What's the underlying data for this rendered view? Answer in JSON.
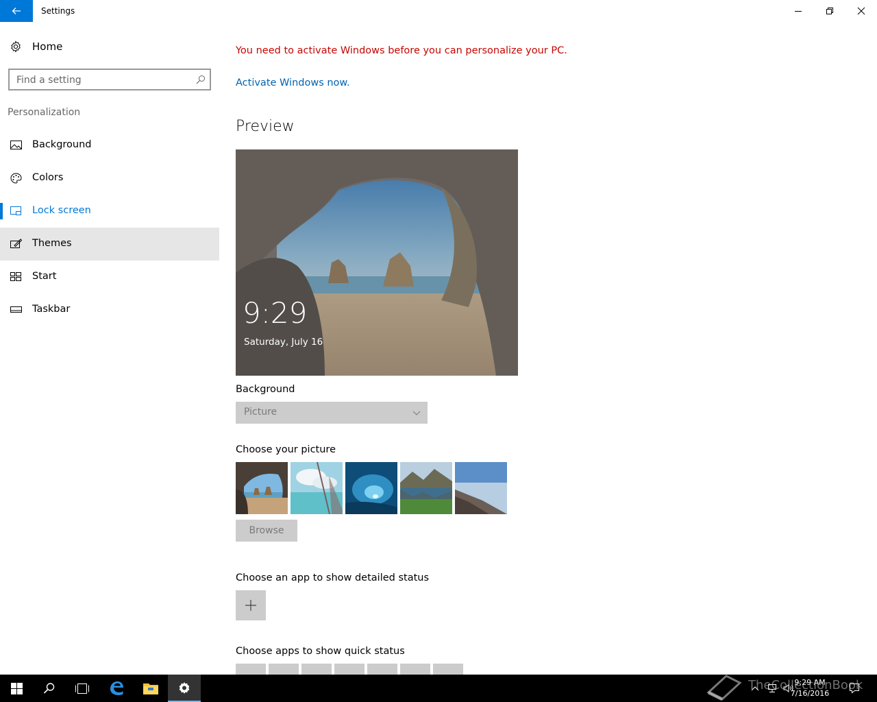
{
  "window": {
    "title": "Settings",
    "back_icon": "arrow-left-icon",
    "minimize_icon": "minimize-icon",
    "restore_icon": "restore-icon",
    "close_icon": "close-icon"
  },
  "sidebar": {
    "home_label": "Home",
    "search_placeholder": "Find a setting",
    "section_title": "Personalization",
    "items": [
      {
        "label": "Background",
        "icon": "picture-icon",
        "selected": false
      },
      {
        "label": "Colors",
        "icon": "palette-icon",
        "selected": false
      },
      {
        "label": "Lock screen",
        "icon": "lock-screen-icon",
        "selected": true
      },
      {
        "label": "Themes",
        "icon": "themes-icon",
        "selected": false,
        "hovered": true
      },
      {
        "label": "Start",
        "icon": "start-icon",
        "selected": false
      },
      {
        "label": "Taskbar",
        "icon": "taskbar-icon",
        "selected": false
      }
    ]
  },
  "main": {
    "activation_warning": "You need to activate Windows before you can personalize your PC.",
    "activation_link": "Activate Windows now.",
    "preview_heading": "Preview",
    "preview_time": "9:29",
    "preview_date": "Saturday, July 16",
    "background_label": "Background",
    "background_value": "Picture",
    "choose_picture_label": "Choose your picture",
    "browse_label": "Browse",
    "detailed_status_label": "Choose an app to show detailed status",
    "quick_status_label": "Choose apps to show quick status",
    "quick_status_slots": 7
  },
  "taskbar": {
    "buttons": [
      "windows-start-icon",
      "search-icon",
      "task-view-icon",
      "edge-icon",
      "file-explorer-icon",
      "settings-icon"
    ],
    "clock_time": "9:29 AM",
    "clock_date": "7/16/2016",
    "watermark": "TheCollectionBook"
  },
  "colors": {
    "accent": "#0078d7",
    "warning": "#c50500",
    "link": "#0063b1",
    "disabled_bg": "#cccccc"
  }
}
